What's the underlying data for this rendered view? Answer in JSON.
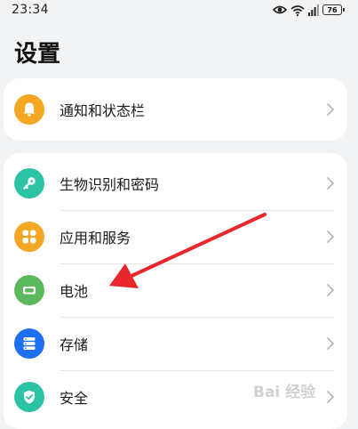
{
  "status": {
    "time": "23:34",
    "battery": "76"
  },
  "page": {
    "title": "设置"
  },
  "notify_card": {
    "items": [
      {
        "label": "通知和状态栏",
        "icon": "bell-icon",
        "color": "#f5a623"
      }
    ]
  },
  "main_card": {
    "items": [
      {
        "label": "生物识别和密码",
        "icon": "key-icon",
        "color": "#2bc3a4"
      },
      {
        "label": "应用和服务",
        "icon": "apps-grid-icon",
        "color": "#f5a623"
      },
      {
        "label": "电池",
        "icon": "battery-icon",
        "color": "#5cb85c"
      },
      {
        "label": "存储",
        "icon": "storage-icon",
        "color": "#1e6ff2"
      },
      {
        "label": "安全",
        "icon": "shield-icon",
        "color": "#2bc3a4"
      }
    ]
  },
  "colors": {
    "annotation_arrow": "#e8262b",
    "background": "#f1f3f5",
    "card": "#ffffff"
  },
  "watermark": {
    "text": "Bai 经验"
  }
}
